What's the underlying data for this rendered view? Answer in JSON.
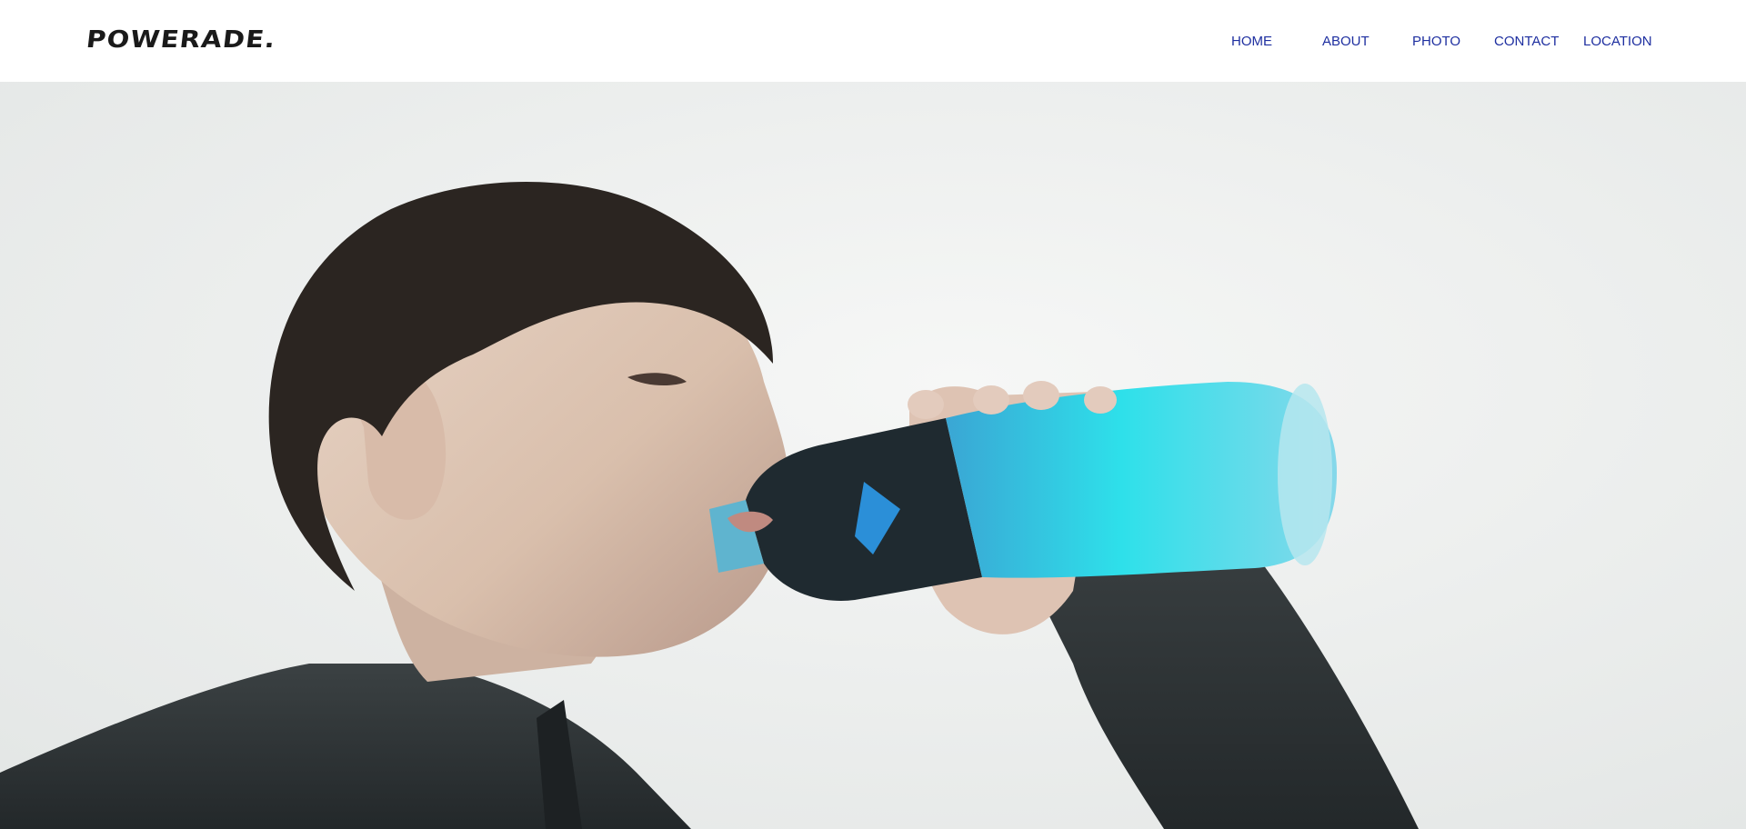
{
  "header": {
    "logo": "POWERADE."
  },
  "nav": {
    "items": [
      {
        "label": "HOME"
      },
      {
        "label": "ABOUT"
      },
      {
        "label": "PHOTO"
      },
      {
        "label": "CONTACT"
      },
      {
        "label": "LOCATION"
      }
    ]
  },
  "colors": {
    "nav_link": "#1e2fa0",
    "logo": "#1a1a1a",
    "sky": "#eef0ef",
    "bottle_liquid": "#27d9e6",
    "jacket": "#33383a",
    "hair": "#2b2521"
  },
  "hero": {
    "image_subject": "person-drinking-blue-sports-drink"
  }
}
